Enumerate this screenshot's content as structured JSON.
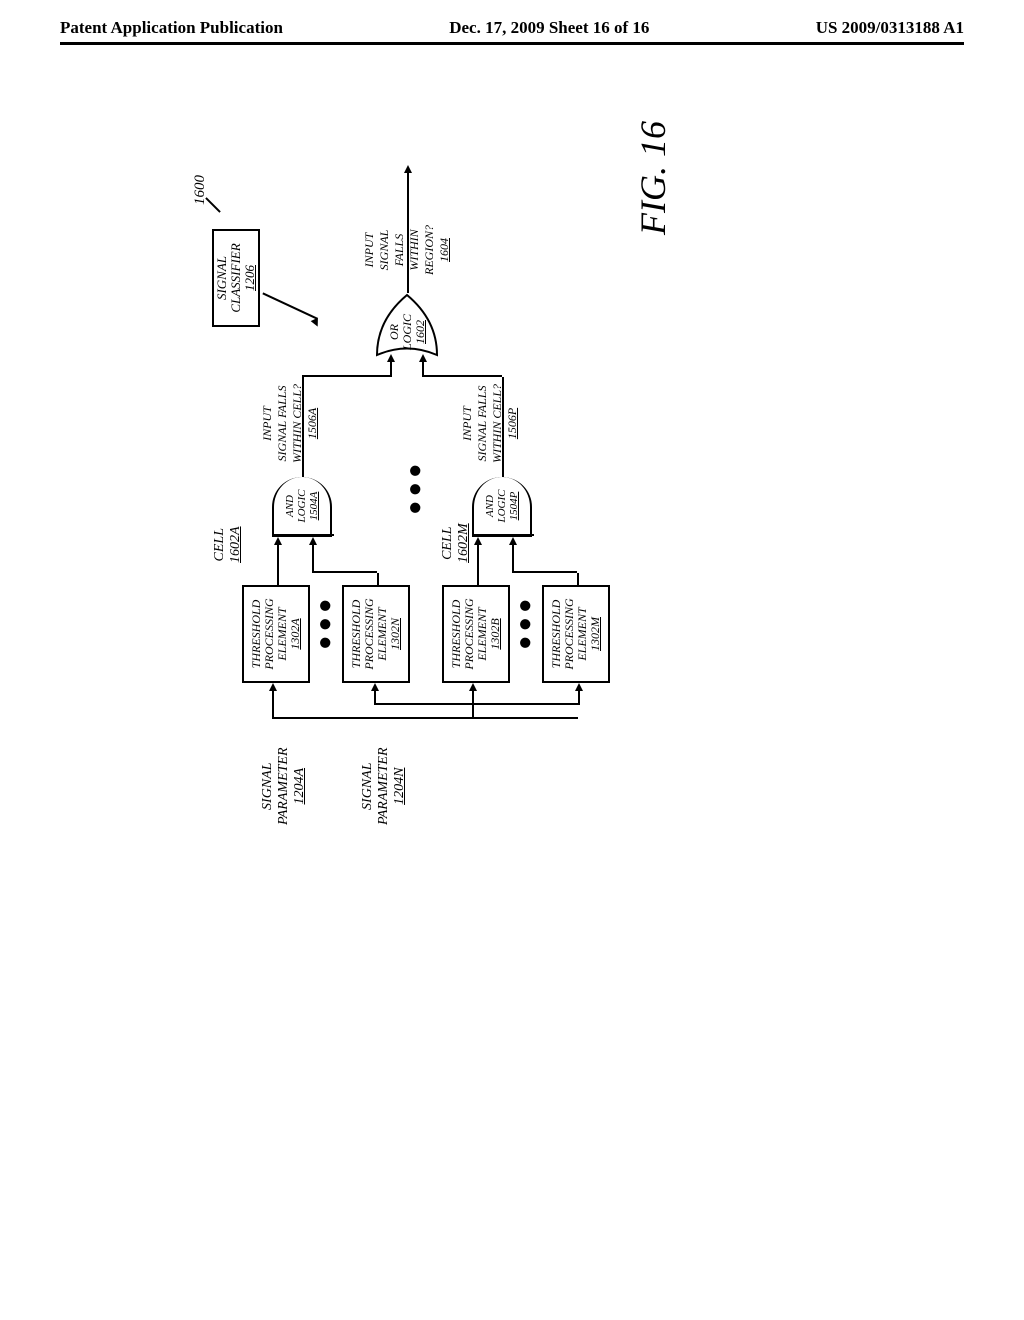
{
  "header": {
    "left": "Patent Application Publication",
    "center": "Dec. 17, 2009  Sheet 16 of 16",
    "right": "US 2009/0313188 A1"
  },
  "signal_parameters": [
    {
      "label": "SIGNAL",
      "sub": "PARAMETER",
      "ref": "1204A"
    },
    {
      "label": "SIGNAL",
      "sub": "PARAMETER",
      "ref": "1204N"
    }
  ],
  "thresholds": [
    {
      "l1": "THRESHOLD",
      "l2": "PROCESSING",
      "l3": "ELEMENT",
      "ref": "1302A"
    },
    {
      "l1": "THRESHOLD",
      "l2": "PROCESSING",
      "l3": "ELEMENT",
      "ref": "1302N"
    },
    {
      "l1": "THRESHOLD",
      "l2": "PROCESSING",
      "l3": "ELEMENT",
      "ref": "1302B"
    },
    {
      "l1": "THRESHOLD",
      "l2": "PROCESSING",
      "l3": "ELEMENT",
      "ref": "1302M"
    }
  ],
  "cells": [
    {
      "label": "CELL",
      "ref": "1602A"
    },
    {
      "label": "CELL",
      "ref": "1602M"
    }
  ],
  "and_gates": [
    {
      "l1": "AND",
      "l2": "LOGIC",
      "ref": "1504A"
    },
    {
      "l1": "AND",
      "l2": "LOGIC",
      "ref": "1504P"
    }
  ],
  "inter_labels": [
    {
      "l1": "INPUT",
      "l2": "SIGNAL FALLS",
      "l3": "WITHIN CELL?",
      "ref": "1506A"
    },
    {
      "l1": "INPUT",
      "l2": "SIGNAL FALLS",
      "l3": "WITHIN CELL?",
      "ref": "1506P"
    }
  ],
  "or_gate": {
    "l1": "OR",
    "l2": "LOGIC",
    "ref": "1602"
  },
  "output": {
    "l1": "INPUT",
    "l2": "SIGNAL",
    "l3": "FALLS",
    "l4": "WITHIN",
    "l5": "REGION?",
    "ref": "1604"
  },
  "classifier": {
    "l1": "SIGNAL",
    "l2": "CLASSIFIER",
    "ref": "1206"
  },
  "figure_ref": "1600",
  "figure_caption": "FIG. 16"
}
